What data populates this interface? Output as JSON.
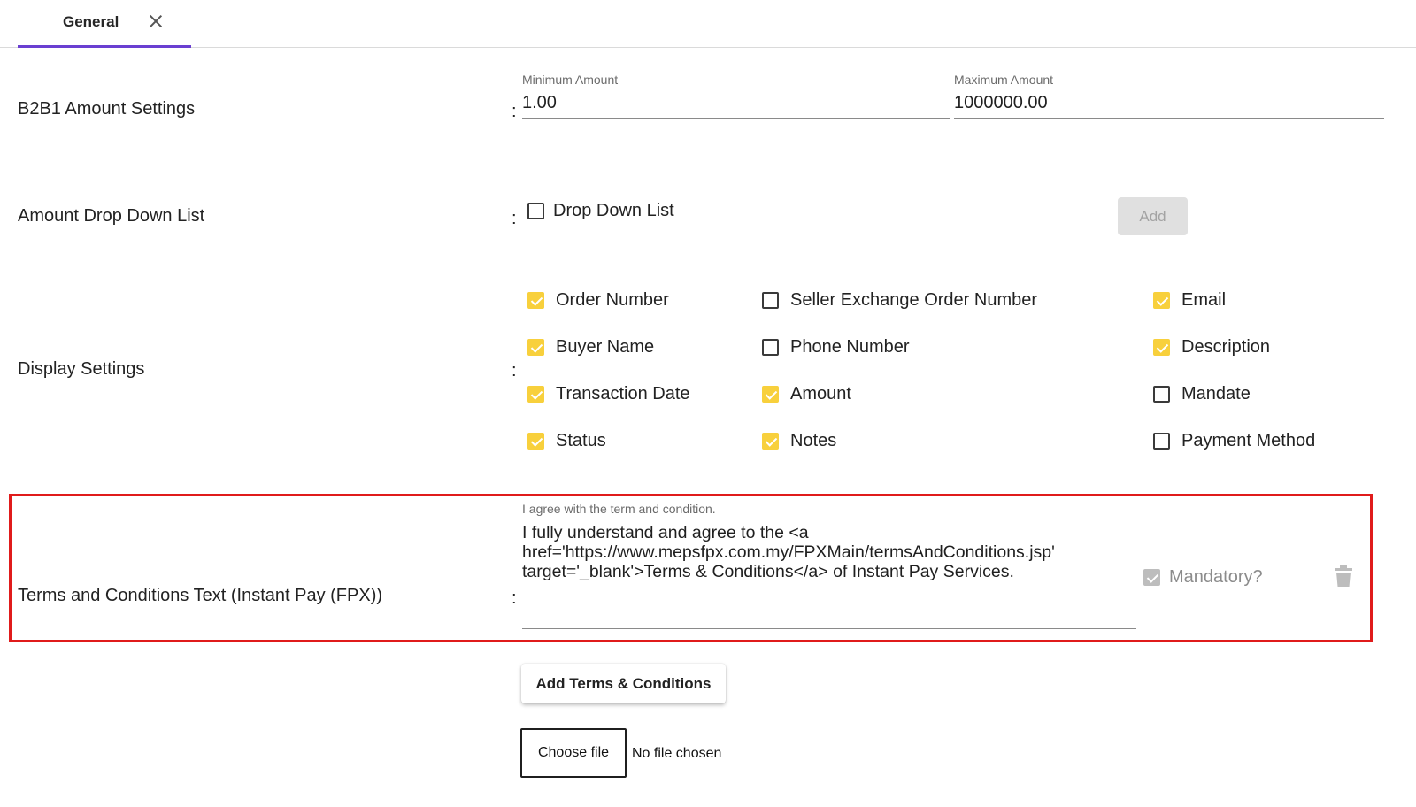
{
  "tab": {
    "label": "General"
  },
  "b2b1": {
    "label": "B2B1 Amount Settings",
    "colon": ":",
    "min_label": "Minimum Amount",
    "min_value": "1.00",
    "max_label": "Maximum Amount",
    "max_value": "1000000.00"
  },
  "dropdown": {
    "label": "Amount Drop Down List",
    "colon": ":",
    "checkbox_label": "Drop Down List",
    "checked": false,
    "add_label": "Add"
  },
  "display": {
    "label": "Display Settings",
    "colon": ":",
    "options": [
      {
        "label": "Order Number",
        "checked": true
      },
      {
        "label": "Seller Exchange Order Number",
        "checked": false
      },
      {
        "label": "Email",
        "checked": true
      },
      {
        "label": "Buyer Name",
        "checked": true
      },
      {
        "label": "Phone Number",
        "checked": false
      },
      {
        "label": "Description",
        "checked": true
      },
      {
        "label": "Transaction Date",
        "checked": true
      },
      {
        "label": "Amount",
        "checked": true
      },
      {
        "label": "Mandate",
        "checked": false
      },
      {
        "label": "Status",
        "checked": true
      },
      {
        "label": "Notes",
        "checked": true
      },
      {
        "label": "Payment Method",
        "checked": false
      }
    ]
  },
  "terms": {
    "label": "Terms and Conditions Text (Instant Pay (FPX))",
    "colon": ":",
    "field_label": "I agree with the term and condition.",
    "text": "I fully understand and agree to the <a href='https://www.mepsfpx.com.my/FPXMain/termsAndConditions.jsp' target='_blank'>Terms & Conditions</a> of Instant Pay Services.",
    "mandatory_label": "Mandatory?",
    "mandatory_checked": true
  },
  "actions": {
    "add_terms_label": "Add Terms & Conditions",
    "choose_file_label": "Choose file",
    "file_status": "No file chosen"
  },
  "colors": {
    "accent": "#6a3fd1",
    "checkbox_checked": "#f8d03c",
    "highlight": "#e01b1b"
  }
}
